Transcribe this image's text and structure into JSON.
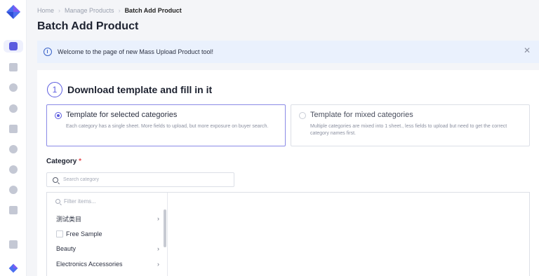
{
  "sidebar": {
    "icons": [
      "logo-icon",
      "product-icon",
      "order-icon",
      "marketing-icon",
      "data-icon",
      "store-icon",
      "finance-icon",
      "service-icon",
      "help-icon",
      "account-icon",
      "notes-icon",
      "logo-icon"
    ]
  },
  "breadcrumb": {
    "items": [
      "Home",
      "Manage Products",
      "Batch Add Product"
    ]
  },
  "page_title": "Batch Add Product",
  "banner": {
    "text": "Welcome to the page of new Mass Upload Product tool!"
  },
  "step": {
    "number": "1",
    "title": "Download template and fill in it"
  },
  "options": [
    {
      "title": "Template for selected categories",
      "desc": "Each category has a single sheet. More fields to upload, but more exposure on buyer search.",
      "selected": true
    },
    {
      "title": "Template for mixed categories",
      "desc": "Multiple categories are mixed into 1 sheet., less fields to upload but need to get the correct category names first.",
      "selected": false
    }
  ],
  "category": {
    "label": "Category",
    "required_mark": "*",
    "search_placeholder": "Search category",
    "filter_placeholder": "Filter items...",
    "items": [
      {
        "label": "测试类目",
        "has_children": true
      },
      {
        "label": "Free Sample",
        "checkbox": true
      },
      {
        "label": "Beauty",
        "has_children": true
      },
      {
        "label": "Electronics Accessories",
        "has_children": true
      }
    ]
  },
  "colors": {
    "accent": "#5b5bdf",
    "banner_bg": "#eaf1fd",
    "required": "#e5484d"
  }
}
